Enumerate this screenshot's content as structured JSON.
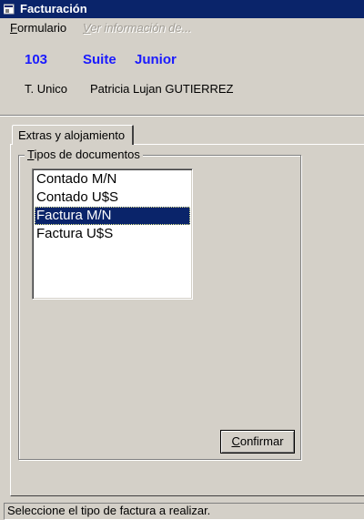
{
  "window": {
    "title": "Facturación"
  },
  "menu": {
    "formulario_first": "F",
    "formulario_rest": "ormulario",
    "verinfo_first": "V",
    "verinfo_rest": "er información de..."
  },
  "header": {
    "room_number": "103",
    "room_type": "Suite",
    "room_category": "Junior",
    "tariff_type": "T. Unico",
    "guest_name": "Patricia Lujan  GUTIERREZ",
    "accent_color": "#1a1aff"
  },
  "tab": {
    "label": "Extras y alojamiento"
  },
  "group": {
    "caption_first": "T",
    "caption_rest": "ipos de documentos"
  },
  "document_types": {
    "items": [
      {
        "label": "Contado M/N"
      },
      {
        "label": "Contado U$S"
      },
      {
        "label": "Factura M/N"
      },
      {
        "label": "Factura U$S"
      }
    ],
    "selected_label": "Factura M/N"
  },
  "confirm_button": {
    "label_first": "C",
    "label_rest": "onfirmar"
  },
  "status": {
    "text": "Seleccione el tipo de factura a realizar."
  },
  "icons": {
    "app_icon": "window-app-icon"
  }
}
